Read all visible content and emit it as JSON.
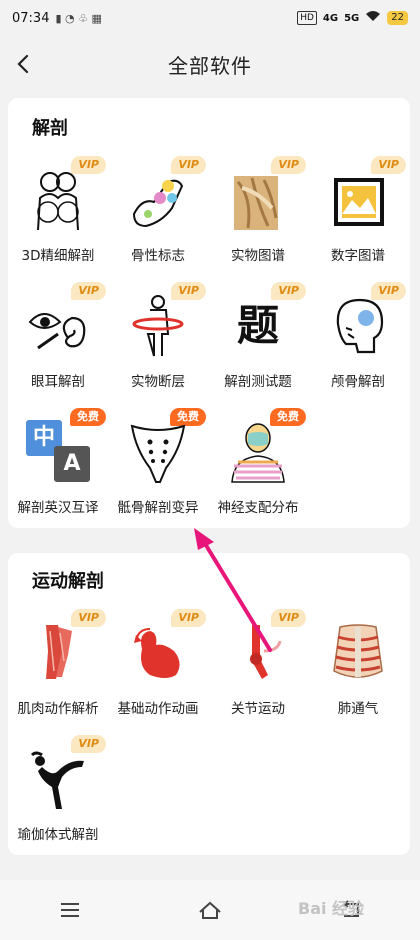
{
  "status": {
    "time": "07:34",
    "network": "4G",
    "network2": "5G",
    "hd": "HD",
    "battery": "22"
  },
  "header": {
    "title": "全部软件"
  },
  "sections": [
    {
      "title": "解剖",
      "items": [
        {
          "label": "3D精细解剖",
          "badge": "VIP",
          "icon": "3d-anatomy-icon"
        },
        {
          "label": "骨性标志",
          "badge": "VIP",
          "icon": "bone-landmark-icon"
        },
        {
          "label": "实物图谱",
          "badge": "VIP",
          "icon": "specimen-atlas-icon"
        },
        {
          "label": "数字图谱",
          "badge": "VIP",
          "icon": "digital-atlas-icon"
        },
        {
          "label": "眼耳解剖",
          "badge": "VIP",
          "icon": "eye-ear-icon"
        },
        {
          "label": "实物断层",
          "badge": "VIP",
          "icon": "cross-section-icon"
        },
        {
          "label": "解剖测试题",
          "badge": "VIP",
          "icon": "quiz-icon",
          "glyph": "题"
        },
        {
          "label": "颅骨解剖",
          "badge": "VIP",
          "icon": "skull-icon"
        },
        {
          "label": "解剖英汉互译",
          "badge": "免费",
          "icon": "translate-icon",
          "glyph_cn": "中",
          "glyph_en": "A"
        },
        {
          "label": "骶骨解剖变异",
          "badge": "免费",
          "icon": "sacrum-icon"
        },
        {
          "label": "神经支配分布",
          "badge": "免费",
          "icon": "nerve-distribution-icon"
        }
      ]
    },
    {
      "title": "运动解剖",
      "items": [
        {
          "label": "肌肉动作解析",
          "badge": "VIP",
          "icon": "muscle-action-icon"
        },
        {
          "label": "基础动作动画",
          "badge": "VIP",
          "icon": "basic-motion-icon"
        },
        {
          "label": "关节运动",
          "badge": "VIP",
          "icon": "joint-motion-icon"
        },
        {
          "label": "肺通气",
          "badge": "",
          "icon": "lung-ventilation-icon"
        },
        {
          "label": "瑜伽体式解剖",
          "badge": "VIP",
          "icon": "yoga-pose-icon"
        }
      ]
    }
  ],
  "watermark": "Bai 经验",
  "colors": {
    "vip_bg": "#fbe7c0",
    "vip_text": "#e08b14",
    "free_bg": "#ff6a21",
    "arrow": "#e8157a"
  }
}
